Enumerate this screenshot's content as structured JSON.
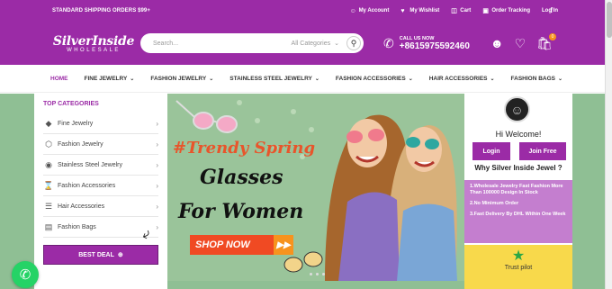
{
  "topbar": {
    "shipping": "STANDARD SHIPPING ORDERS $99+",
    "links": [
      {
        "label": "My Account",
        "icon": "user-icon"
      },
      {
        "label": "My Wishlist",
        "icon": "heart-icon"
      },
      {
        "label": "Cart",
        "icon": "cart-icon"
      },
      {
        "label": "Order Tracking",
        "icon": "truck-icon"
      },
      {
        "label": "Log In",
        "icon": ""
      }
    ],
    "social": "f"
  },
  "header": {
    "logo_main": "SilverInside",
    "logo_sub": "WHOLESALE",
    "search_placeholder": "Search...",
    "search_category": "All Categories",
    "call_label": "CALL US NOW",
    "phone": "+8615975592460",
    "cart_count": "0"
  },
  "nav": {
    "items": [
      {
        "label": "HOME",
        "active": true
      },
      {
        "label": "FINE JEWELRY"
      },
      {
        "label": "FASHION JEWELRY"
      },
      {
        "label": "STAINLESS STEEL JEWELRY"
      },
      {
        "label": "FASHION ACCESSORIES"
      },
      {
        "label": "HAIR ACCESSORIES"
      },
      {
        "label": "FASHION BAGS"
      }
    ]
  },
  "categories": {
    "title": "TOP CATEGORIES",
    "items": [
      {
        "label": "Fine Jewelry",
        "icon": "diamond-icon"
      },
      {
        "label": "Fashion Jewelry",
        "icon": "hexagon-icon"
      },
      {
        "label": "Stainless Steel Jewelry",
        "icon": "ring-icon"
      },
      {
        "label": "Fashion Accessories",
        "icon": "hourglass-icon"
      },
      {
        "label": "Hair Accessories",
        "icon": "comb-icon"
      },
      {
        "label": "Fashion Bags",
        "icon": "bag-icon"
      }
    ],
    "best_deal": "BEST DEAL"
  },
  "banner": {
    "line1": "#Trendy Spring",
    "line2": "Glasses",
    "line3": "For Women",
    "cta": "SHOP NOW"
  },
  "side": {
    "greeting": "Hi Welcome!",
    "login": "Login",
    "join": "Join Free",
    "why": "Why Silver Inside Jewel ?",
    "reasons": [
      "1.Wholesale Jewelry Fast Fashion More Than 100000 Design In Stock",
      "2.No Minimum Order",
      "3.Fast Delivery By DHL Within One Week"
    ],
    "trust": "Trust pilot"
  },
  "colors": {
    "brand": "#9b2ba6",
    "accent": "#f04a23",
    "banner_bg": "#9ac49a"
  }
}
